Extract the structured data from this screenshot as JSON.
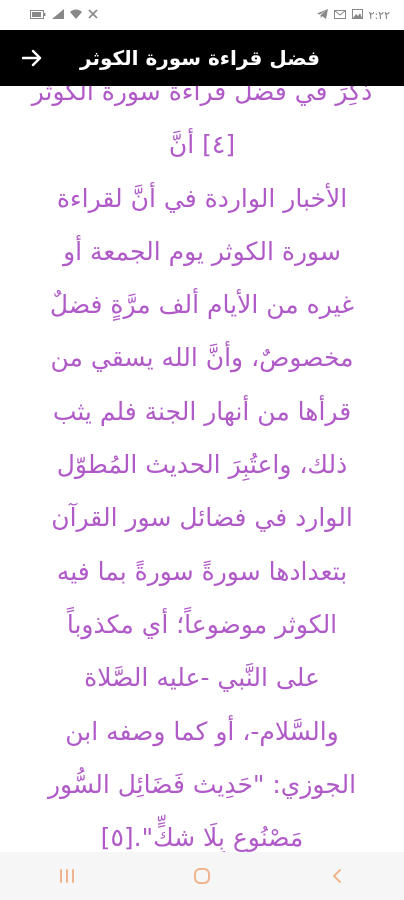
{
  "status_bar": {
    "time": "٢:٢٢",
    "icons_left": [
      "battery-icon",
      "signal-icon",
      "wifi-icon",
      "mute-icon"
    ],
    "icons_right": [
      "telegram-icon",
      "gmail-icon",
      "gallery-icon"
    ]
  },
  "app_bar": {
    "title": "فضل قراءة سورة الكوثر",
    "back_icon": "arrow-right-icon"
  },
  "article": {
    "text": "ذُكِرَ في فضل قراءة سورة الكوثر [٤] أنَّ\nالأخبار الواردة في أنَّ لقراءة\nسورة الكوثر يوم الجمعة أو\nغيره من الأيام ألف مرَّةٍ فضلٌ\nمخصوصٌ، وأنَّ الله يسقي من\nقرأها من أنهار الجنة فلم يثب\nذلك، واعتُبِرَ الحديث المُطوّل\nالوارد في فضائل سور القرآن\nبتعدادها سورةً سورةً بما فيه\nالكوثر موضوعاً؛ أي مكذوباً\nعلى النَّبي -عليه الصَّلاة\nوالسَّلام-، أو كما وصفه ابن\nالجوزي: \"حَدِيث فَضَائِل السُّور\nمَصْنُوع بِلَا شكٍّ\".[٥]",
    "color": "#b05ac8"
  },
  "nav_bar": {
    "items": [
      "recent-apps-icon",
      "home-icon",
      "back-icon"
    ]
  }
}
